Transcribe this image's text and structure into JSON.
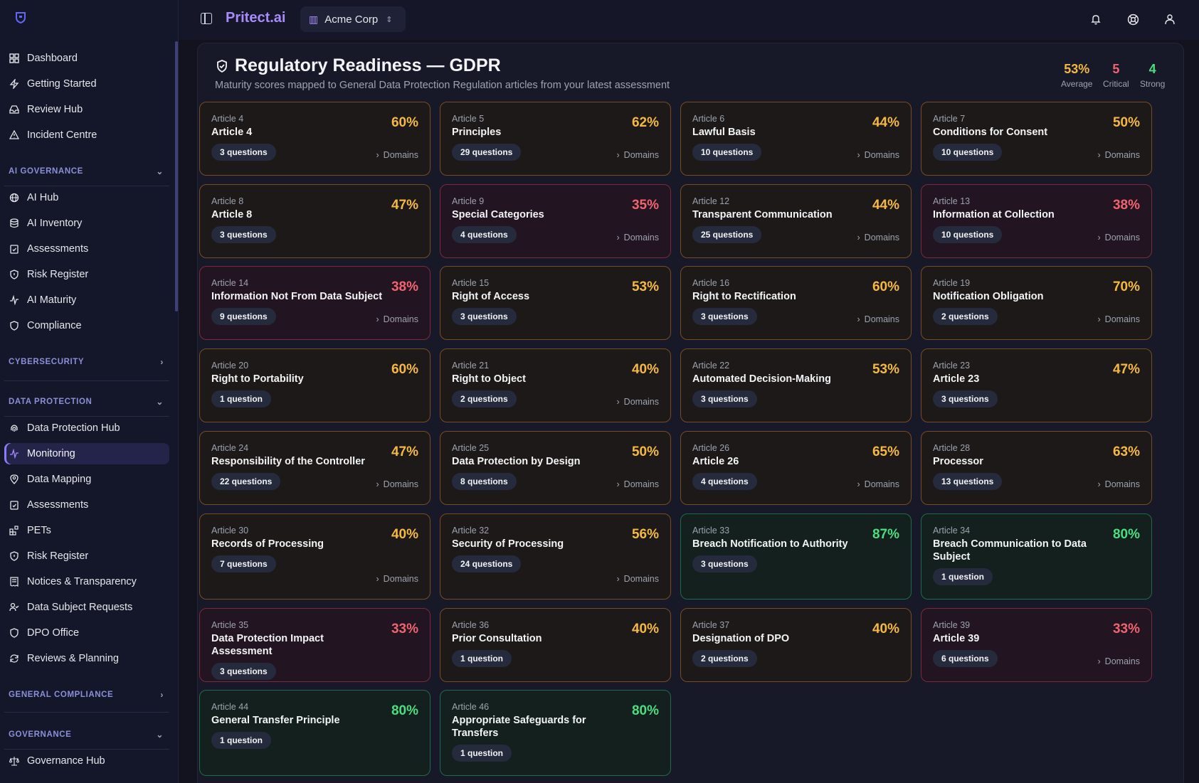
{
  "app": {
    "brand": "Pritect.ai",
    "org": "Acme Corp"
  },
  "sidebar": {
    "top": [
      "Dashboard",
      "Getting Started",
      "Review Hub",
      "Incident Centre"
    ],
    "sections": [
      {
        "label": "AI GOVERNANCE",
        "expanded": true,
        "items": [
          "AI Hub",
          "AI Inventory",
          "Assessments",
          "Risk Register",
          "AI Maturity",
          "Compliance"
        ]
      },
      {
        "label": "CYBERSECURITY",
        "expanded": false,
        "items": []
      },
      {
        "label": "DATA PROTECTION",
        "expanded": true,
        "items": [
          "Data Protection Hub",
          "Monitoring",
          "Data Mapping",
          "Assessments",
          "PETs",
          "Risk Register",
          "Notices & Transparency",
          "Data Subject Requests",
          "DPO Office",
          "Reviews & Planning"
        ]
      },
      {
        "label": "GENERAL COMPLIANCE",
        "expanded": false,
        "items": []
      },
      {
        "label": "GOVERNANCE",
        "expanded": true,
        "items": [
          "Governance Hub"
        ]
      }
    ],
    "active": "Monitoring"
  },
  "header": {
    "title": "Regulatory Readiness — GDPR",
    "subtitle": "Maturity scores mapped to General Data Protection Regulation articles from your latest assessment",
    "stats": [
      {
        "value": "53%",
        "label": "Average",
        "color": "#f5b942"
      },
      {
        "value": "5",
        "label": "Critical",
        "color": "#f0646f"
      },
      {
        "value": "4",
        "label": "Strong",
        "color": "#4ade80"
      }
    ]
  },
  "domains_label": "Domains",
  "articles": [
    {
      "num": "Article 4",
      "name": "Article 4",
      "pct": "60%",
      "questions": "3 questions",
      "domains": true,
      "tone": "amber"
    },
    {
      "num": "Article 5",
      "name": "Principles",
      "pct": "62%",
      "questions": "29 questions",
      "domains": true,
      "tone": "amber"
    },
    {
      "num": "Article 6",
      "name": "Lawful Basis",
      "pct": "44%",
      "questions": "10 questions",
      "domains": true,
      "tone": "amber"
    },
    {
      "num": "Article 7",
      "name": "Conditions for Consent",
      "pct": "50%",
      "questions": "10 questions",
      "domains": true,
      "tone": "amber"
    },
    {
      "num": "Article 8",
      "name": "Article 8",
      "pct": "47%",
      "questions": "3 questions",
      "domains": false,
      "tone": "amber"
    },
    {
      "num": "Article 9",
      "name": "Special Categories",
      "pct": "35%",
      "questions": "4 questions",
      "domains": true,
      "tone": "red"
    },
    {
      "num": "Article 12",
      "name": "Transparent Communication",
      "pct": "44%",
      "questions": "25 questions",
      "domains": true,
      "tone": "amber"
    },
    {
      "num": "Article 13",
      "name": "Information at Collection",
      "pct": "38%",
      "questions": "10 questions",
      "domains": true,
      "tone": "red"
    },
    {
      "num": "Article 14",
      "name": "Information Not From Data Subject",
      "pct": "38%",
      "questions": "9 questions",
      "domains": true,
      "tone": "red"
    },
    {
      "num": "Article 15",
      "name": "Right of Access",
      "pct": "53%",
      "questions": "3 questions",
      "domains": false,
      "tone": "amber"
    },
    {
      "num": "Article 16",
      "name": "Right to Rectification",
      "pct": "60%",
      "questions": "3 questions",
      "domains": true,
      "tone": "amber"
    },
    {
      "num": "Article 19",
      "name": "Notification Obligation",
      "pct": "70%",
      "questions": "2 questions",
      "domains": true,
      "tone": "amber"
    },
    {
      "num": "Article 20",
      "name": "Right to Portability",
      "pct": "60%",
      "questions": "1 question",
      "domains": false,
      "tone": "amber"
    },
    {
      "num": "Article 21",
      "name": "Right to Object",
      "pct": "40%",
      "questions": "2 questions",
      "domains": true,
      "tone": "amber"
    },
    {
      "num": "Article 22",
      "name": "Automated Decision-Making",
      "pct": "53%",
      "questions": "3 questions",
      "domains": false,
      "tone": "amber"
    },
    {
      "num": "Article 23",
      "name": "Article 23",
      "pct": "47%",
      "questions": "3 questions",
      "domains": false,
      "tone": "amber"
    },
    {
      "num": "Article 24",
      "name": "Responsibility of the Controller",
      "pct": "47%",
      "questions": "22 questions",
      "domains": true,
      "tone": "amber"
    },
    {
      "num": "Article 25",
      "name": "Data Protection by Design",
      "pct": "50%",
      "questions": "8 questions",
      "domains": true,
      "tone": "amber"
    },
    {
      "num": "Article 26",
      "name": "Article 26",
      "pct": "65%",
      "questions": "4 questions",
      "domains": true,
      "tone": "amber"
    },
    {
      "num": "Article 28",
      "name": "Processor",
      "pct": "63%",
      "questions": "13 questions",
      "domains": true,
      "tone": "amber"
    },
    {
      "num": "Article 30",
      "name": "Records of Processing",
      "pct": "40%",
      "questions": "7 questions",
      "domains": true,
      "tone": "amber"
    },
    {
      "num": "Article 32",
      "name": "Security of Processing",
      "pct": "56%",
      "questions": "24 questions",
      "domains": true,
      "tone": "amber"
    },
    {
      "num": "Article 33",
      "name": "Breach Notification to Authority",
      "pct": "87%",
      "questions": "3 questions",
      "domains": false,
      "tone": "green"
    },
    {
      "num": "Article 34",
      "name": "Breach Communication to Data Subject",
      "pct": "80%",
      "questions": "1 question",
      "domains": false,
      "tone": "green"
    },
    {
      "num": "Article 35",
      "name": "Data Protection Impact Assessment",
      "pct": "33%",
      "questions": "3 questions",
      "domains": false,
      "tone": "red"
    },
    {
      "num": "Article 36",
      "name": "Prior Consultation",
      "pct": "40%",
      "questions": "1 question",
      "domains": false,
      "tone": "amber"
    },
    {
      "num": "Article 37",
      "name": "Designation of DPO",
      "pct": "40%",
      "questions": "2 questions",
      "domains": false,
      "tone": "amber"
    },
    {
      "num": "Article 39",
      "name": "Article 39",
      "pct": "33%",
      "questions": "6 questions",
      "domains": true,
      "tone": "red"
    },
    {
      "num": "Article 44",
      "name": "General Transfer Principle",
      "pct": "80%",
      "questions": "1 question",
      "domains": false,
      "tone": "green"
    },
    {
      "num": "Article 46",
      "name": "Appropriate Safeguards for Transfers",
      "pct": "80%",
      "questions": "1 question",
      "domains": false,
      "tone": "green"
    }
  ]
}
